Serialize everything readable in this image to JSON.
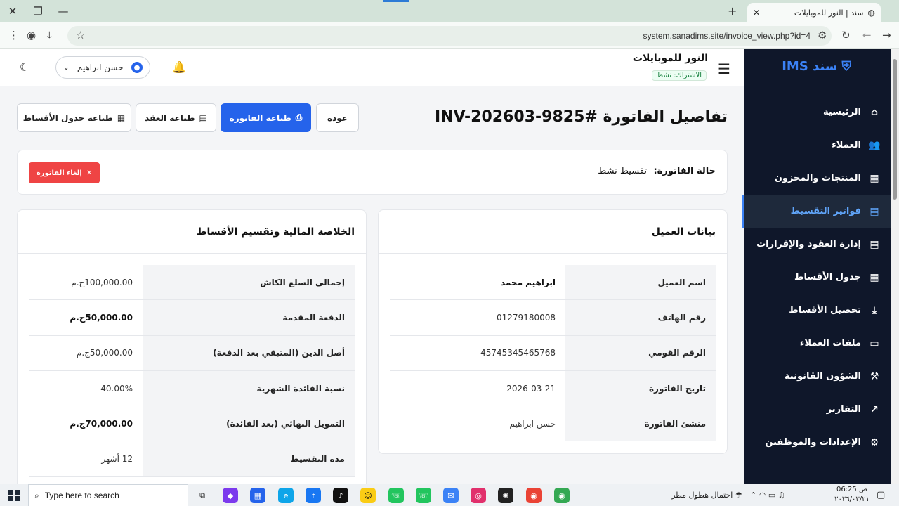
{
  "browser": {
    "tab_title": "سند | النور للموبايلات",
    "url": "system.sanadims.site/invoice_view.php?id=4"
  },
  "sidebar": {
    "brand": "سند IMS",
    "items": [
      {
        "label": "الرئيسية",
        "icon": "home-icon"
      },
      {
        "label": "العملاء",
        "icon": "users-icon"
      },
      {
        "label": "المنتجات والمخزون",
        "icon": "box-icon"
      },
      {
        "label": "فواتير التقسيط",
        "icon": "invoice-icon",
        "active": true
      },
      {
        "label": "إدارة العقود والإقرارات",
        "icon": "document-icon"
      },
      {
        "label": "جدول الأقساط",
        "icon": "calendar-icon"
      },
      {
        "label": "تحصيل الأقساط",
        "icon": "collect-icon"
      },
      {
        "label": "ملفات العملاء",
        "icon": "folder-icon"
      },
      {
        "label": "الشؤون القانونية",
        "icon": "gavel-icon"
      },
      {
        "label": "التقارير",
        "icon": "chart-icon"
      },
      {
        "label": "الإعدادات والموظفين",
        "icon": "gear-icon"
      }
    ]
  },
  "header": {
    "store_name": "النور للموبايلات",
    "subscription": "الاشتراك: نشط",
    "user_name": "حسن ابراهيم"
  },
  "page": {
    "title": "تفاصيل الفاتورة #INV-202603-9825",
    "buttons": {
      "back": "عودة",
      "print_invoice": "طباعة الفاتورة",
      "print_contract": "طباعة العقد",
      "print_schedule": "طباعة جدول الأقساط"
    }
  },
  "status": {
    "label": "حالة الفاتورة:",
    "value": "تقسيط نشط",
    "cancel": "إلغاء الفاتورة"
  },
  "client": {
    "title": "بيانات العميل",
    "rows": [
      {
        "key": "اسم العميل",
        "value": "ابراهيم محمد",
        "bold": true
      },
      {
        "key": "رقم الهاتف",
        "value": "01279180008"
      },
      {
        "key": "الرقم القومي",
        "value": "45745345465768"
      },
      {
        "key": "تاريخ الفاتورة",
        "value": "2026-03-21"
      },
      {
        "key": "منشئ الفاتورة",
        "value": "حسن ابراهيم"
      }
    ]
  },
  "summary": {
    "title": "الخلاصة المالية وتقسيم الأقساط",
    "rows": [
      {
        "key": "إجمالي السلع الكاش",
        "value": "100,000.00ج.م"
      },
      {
        "key": "الدفعة المقدمة",
        "value": "50,000.00ج.م",
        "bold": true
      },
      {
        "key": "أصل الدين (المتبقي بعد الدفعة)",
        "value": "50,000.00ج.م"
      },
      {
        "key": "نسبة الفائدة الشهرية",
        "value": "40.00%"
      },
      {
        "key": "التمويل النهائي (بعد الفائدة)",
        "value": "70,000.00ج.م",
        "bold": true
      },
      {
        "key": "مدة التقسيط",
        "value": "12 أشهر"
      }
    ]
  },
  "taskbar": {
    "search_placeholder": "Type here to search",
    "weather": "احتمال هطول مطر",
    "time": "06:25 ص",
    "date": "٢٠٢٦/٠٣/٢١"
  }
}
